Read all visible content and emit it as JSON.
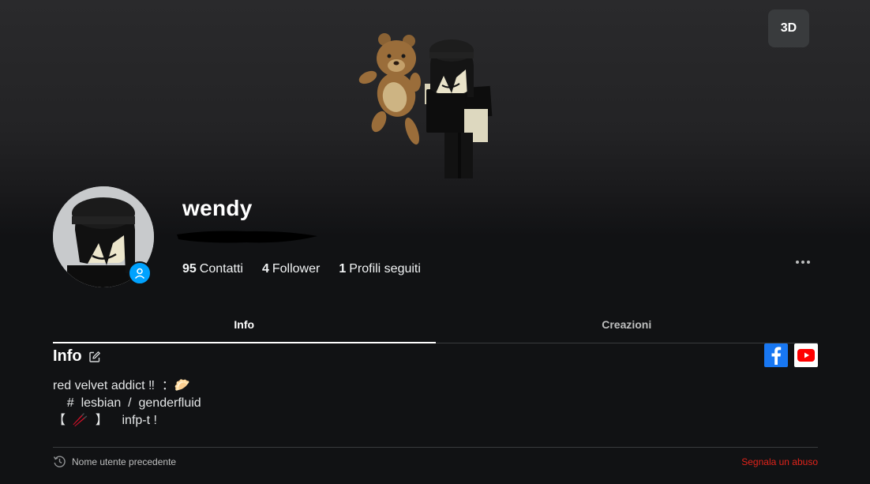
{
  "hero": {
    "toggle_3d_label": "3D"
  },
  "profile": {
    "display_name": "wendy",
    "stats": [
      {
        "count": "95",
        "label": "Contatti"
      },
      {
        "count": "4",
        "label": "Follower"
      },
      {
        "count": "1",
        "label": "Profili seguiti"
      }
    ]
  },
  "tabs": [
    {
      "label": "Info",
      "active": true
    },
    {
      "label": "Creazioni",
      "active": false
    }
  ],
  "info": {
    "title": "Info",
    "bio_lines": [
      "red velvet addict ‼  ：🥟",
      "    #  lesbian  /  genderfluid",
      "【  🥢  】    infp-t !"
    ]
  },
  "footer": {
    "previous_usernames_label": "Nome utente precedente",
    "report_label": "Segnala un abuso"
  },
  "colors": {
    "background": "#111214",
    "accent_blue": "#00a2ff",
    "facebook": "#1877f2",
    "youtube": "#ff0000",
    "report_red": "#e2231a"
  },
  "icons": {
    "edit": "pencil-square-icon",
    "history": "history-clock-icon",
    "more": "more-horizontal-icon",
    "facebook": "facebook-icon",
    "youtube": "youtube-icon",
    "status": "user-silhouette-icon"
  }
}
